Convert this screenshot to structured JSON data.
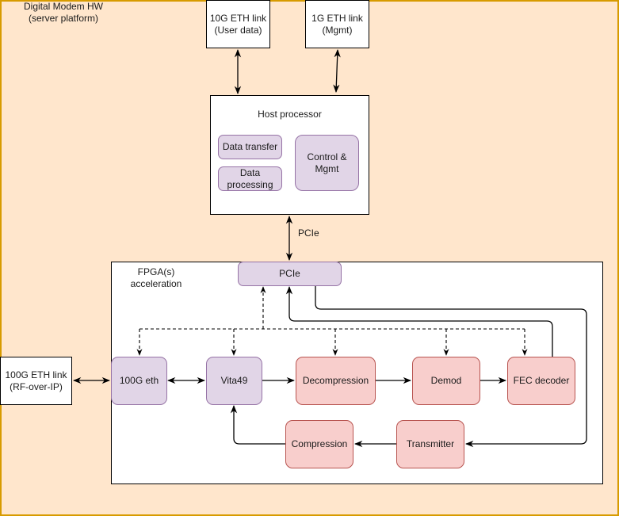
{
  "diagram": {
    "container_title": "Digital Modem HW\n(server platform)",
    "external_links": {
      "eth_10g": "10G ETH link\n(User data)",
      "eth_1g": "1G ETH link\n(Mgmt)",
      "eth_100g": "100G ETH link\n(RF-over-IP)"
    },
    "host": {
      "title": "Host processor",
      "blocks": {
        "data_transfer": "Data transfer",
        "data_processing": "Data\nprocessing",
        "control_mgmt": "Control &\nMgmt"
      }
    },
    "pcie_label": "PCIe",
    "fpga": {
      "title": "FPGA(s)\nacceleration",
      "blocks": {
        "pcie": "PCIe",
        "eth_100g": "100G eth",
        "vita49": "Vita49",
        "decompression": "Decompression",
        "demod": "Demod",
        "fec_decoder": "FEC decoder",
        "compression": "Compression",
        "transmitter": "Transmitter"
      }
    },
    "colors": {
      "background": "#ffe6cc",
      "container_border": "#d79b00",
      "interface_fill": "#e1d5e7",
      "interface_border": "#9673a6",
      "processing_fill": "#f8cecc",
      "processing_border": "#b85450"
    }
  }
}
